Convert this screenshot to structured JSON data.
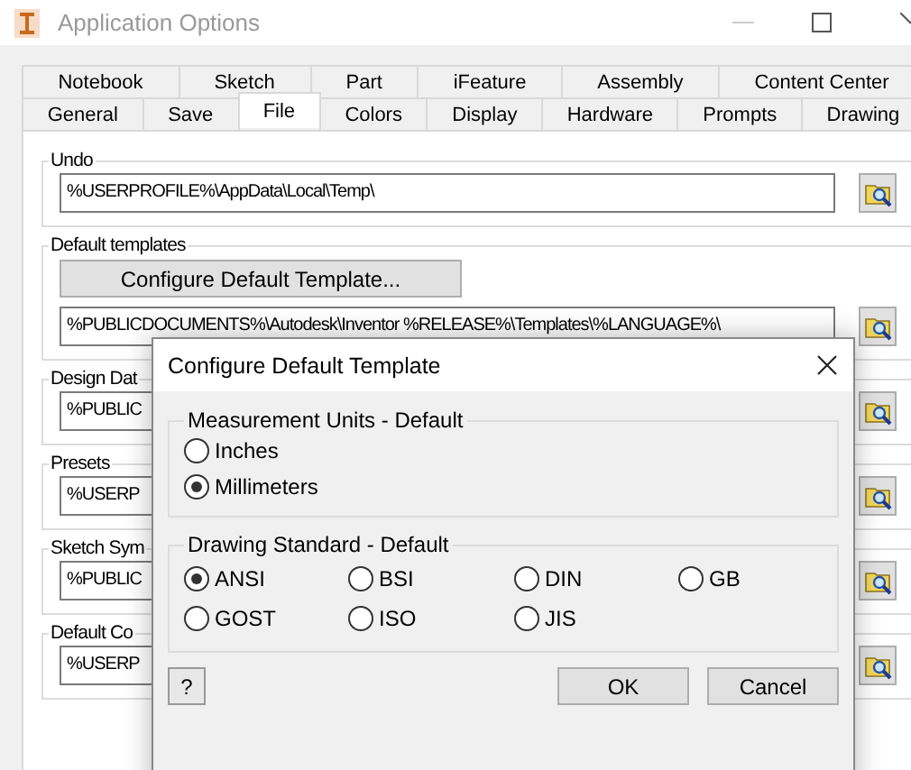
{
  "window": {
    "title": "Application Options"
  },
  "tab_rows": [
    [
      {
        "label": "Notebook",
        "selected": false
      },
      {
        "label": "Sketch",
        "selected": false
      },
      {
        "label": "Part",
        "selected": false
      },
      {
        "label": "iFeature",
        "selected": false
      },
      {
        "label": "Assembly",
        "selected": false
      },
      {
        "label": "Content Center",
        "selected": false
      }
    ],
    [
      {
        "label": "General",
        "selected": false
      },
      {
        "label": "Save",
        "selected": false
      },
      {
        "label": "File",
        "selected": true
      },
      {
        "label": "Colors",
        "selected": false
      },
      {
        "label": "Display",
        "selected": false
      },
      {
        "label": "Hardware",
        "selected": false
      },
      {
        "label": "Prompts",
        "selected": false
      },
      {
        "label": "Drawing",
        "selected": false
      }
    ]
  ],
  "groups": [
    {
      "legend": "Undo",
      "path": "%USERPROFILE%\\AppData\\Local\\Temp\\"
    },
    {
      "legend": "Default templates",
      "button": "Configure Default Template...",
      "path": "%PUBLICDOCUMENTS%\\Autodesk\\Inventor %RELEASE%\\Templates\\%LANGUAGE%\\"
    },
    {
      "legend": "Design Dat",
      "path": "%PUBLIC"
    },
    {
      "legend": "Presets",
      "path": "%USERP"
    },
    {
      "legend": "Sketch Sym",
      "path": "%PUBLIC"
    },
    {
      "legend": "Default Co",
      "path": "%USERP"
    }
  ],
  "dialog": {
    "title": "Configure Default Template",
    "units": {
      "legend": "Measurement Units - Default",
      "options": [
        {
          "label": "Inches",
          "selected": false
        },
        {
          "label": "Millimeters",
          "selected": true
        }
      ]
    },
    "standard": {
      "legend": "Drawing Standard - Default",
      "options": [
        {
          "label": "ANSI",
          "selected": true
        },
        {
          "label": "BSI",
          "selected": false
        },
        {
          "label": "DIN",
          "selected": false
        },
        {
          "label": "GB",
          "selected": false
        },
        {
          "label": "GOST",
          "selected": false
        },
        {
          "label": "ISO",
          "selected": false
        },
        {
          "label": "JIS",
          "selected": false
        }
      ]
    },
    "help": "?",
    "buttons": [
      "OK",
      "Cancel"
    ]
  }
}
